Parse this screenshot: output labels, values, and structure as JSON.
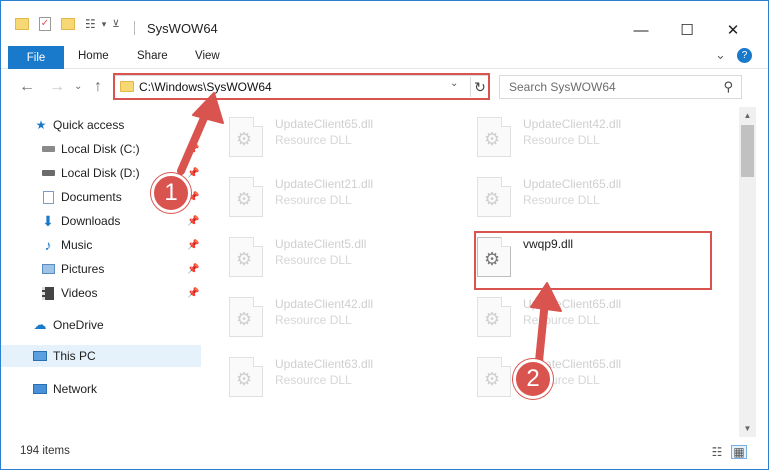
{
  "window": {
    "title": "SysWOW64",
    "minimize": "—",
    "maximize": "☐",
    "close": "✕"
  },
  "ribbon": {
    "tabs": [
      "File",
      "Home",
      "Share",
      "View"
    ],
    "collapse": "⌄",
    "help": "?"
  },
  "address": {
    "path": "C:\\Windows\\SysWOW64",
    "dropdown": "⌄",
    "refresh": "↻"
  },
  "search": {
    "placeholder": "Search SysWOW64"
  },
  "sidebar": {
    "items": [
      {
        "label": "Quick access",
        "icon": "star-icon",
        "pinned": false
      },
      {
        "label": "Local Disk (C:)",
        "icon": "drive-icon",
        "pinned": true
      },
      {
        "label": "Local Disk (D:)",
        "icon": "drive-icon",
        "pinned": true
      },
      {
        "label": "Documents",
        "icon": "documents-icon",
        "pinned": true
      },
      {
        "label": "Downloads",
        "icon": "download-icon",
        "pinned": true
      },
      {
        "label": "Music",
        "icon": "music-icon",
        "pinned": true
      },
      {
        "label": "Pictures",
        "icon": "pictures-icon",
        "pinned": true
      },
      {
        "label": "Videos",
        "icon": "videos-icon",
        "pinned": true
      },
      {
        "label": "OneDrive",
        "icon": "cloud-icon",
        "pinned": false
      },
      {
        "label": "This PC",
        "icon": "computer-icon",
        "pinned": false
      },
      {
        "label": "Network",
        "icon": "network-icon",
        "pinned": false
      }
    ]
  },
  "files": {
    "left": [
      {
        "name": "UpdateClient65.dll",
        "type": "Resource DLL"
      },
      {
        "name": "UpdateClient21.dll",
        "type": "Resource DLL"
      },
      {
        "name": "UpdateClient5.dll",
        "type": "Resource DLL"
      },
      {
        "name": "UpdateClient42.dll",
        "type": "Resource DLL"
      },
      {
        "name": "UpdateClient63.dll",
        "type": "Resource DLL"
      }
    ],
    "right": [
      {
        "name": "UpdateClient42.dll",
        "type": "Resource DLL"
      },
      {
        "name": "UpdateClient65.dll",
        "type": "Resource DLL"
      },
      {
        "name": "vwqp9.dll",
        "type": ""
      },
      {
        "name": "UpdateClient65.dll",
        "type": "Resource DLL"
      },
      {
        "name": "UpdateClient65.dll",
        "type": "Resource DLL"
      }
    ]
  },
  "status": {
    "item_count": "194 items"
  },
  "annotations": {
    "step1": "1",
    "step2": "2",
    "color": "#d9534f"
  }
}
